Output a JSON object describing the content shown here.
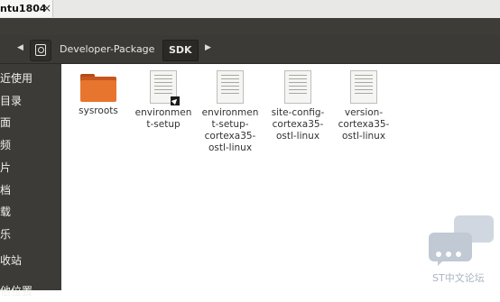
{
  "tab": {
    "title": "ntu1804",
    "close_glyph": "×"
  },
  "toolbar": {
    "back_glyph": "◀",
    "forward_glyph": "▶",
    "home_icon": "drive-icon",
    "breadcrumbs": [
      "Developer-Package",
      "SDK"
    ]
  },
  "sidebar": {
    "items": [
      {
        "label": "近使用"
      },
      {
        "label": "目录"
      },
      {
        "label": "面"
      },
      {
        "label": "频"
      },
      {
        "label": "片"
      },
      {
        "label": "档"
      },
      {
        "label": "载"
      },
      {
        "label": "乐"
      },
      {
        "label": "收站"
      },
      {
        "label": "他位置"
      }
    ]
  },
  "files": [
    {
      "name": "sysroots",
      "type": "folder"
    },
    {
      "name": "environment-setup",
      "display": "environmen t-setup",
      "type": "script"
    },
    {
      "name": "environment-setup-cortexa35-ostl-linux",
      "display": "environmen t-setup- cortexa35- ostl-linux",
      "type": "text"
    },
    {
      "name": "site-config-cortexa35-ostl-linux",
      "display": "site-config- cortexa35- ostl-linux",
      "type": "text"
    },
    {
      "name": "version-cortexa35-ostl-linux",
      "display": "version- cortexa35- ostl-linux",
      "type": "text"
    }
  ],
  "watermark": {
    "text": "ST中文论坛"
  },
  "colors": {
    "folder": "#e8752e",
    "sidebar": "#3c3b37",
    "toolbar": "#3b3a36"
  }
}
